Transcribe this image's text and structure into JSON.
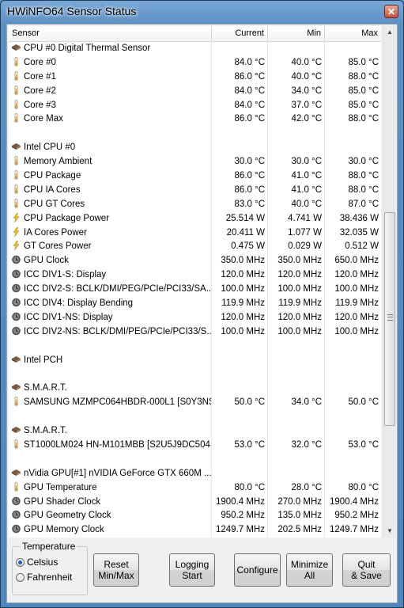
{
  "window": {
    "title": "HWiNFO64 Sensor Status",
    "close_label": "✕"
  },
  "columns": {
    "sensor": "Sensor",
    "current": "Current",
    "min": "Min",
    "max": "Max"
  },
  "rows": [
    {
      "name": "CPU #0 Digital Thermal Sensor",
      "icon": "chip",
      "current": "",
      "min": "",
      "max": ""
    },
    {
      "name": "Core #0",
      "icon": "thermometer",
      "current": "84.0 °C",
      "min": "40.0 °C",
      "max": "85.0 °C"
    },
    {
      "name": "Core #1",
      "icon": "thermometer",
      "current": "86.0 °C",
      "min": "40.0 °C",
      "max": "88.0 °C"
    },
    {
      "name": "Core #2",
      "icon": "thermometer",
      "current": "84.0 °C",
      "min": "34.0 °C",
      "max": "85.0 °C"
    },
    {
      "name": "Core #3",
      "icon": "thermometer",
      "current": "84.0 °C",
      "min": "37.0 °C",
      "max": "85.0 °C"
    },
    {
      "name": "Core Max",
      "icon": "thermometer",
      "current": "86.0 °C",
      "min": "42.0 °C",
      "max": "88.0 °C"
    },
    {
      "name": "",
      "icon": "",
      "current": "",
      "min": "",
      "max": ""
    },
    {
      "name": "Intel CPU #0",
      "icon": "chip",
      "current": "",
      "min": "",
      "max": ""
    },
    {
      "name": "Memory Ambient",
      "icon": "thermometer",
      "current": "30.0 °C",
      "min": "30.0 °C",
      "max": "30.0 °C"
    },
    {
      "name": "CPU Package",
      "icon": "thermometer",
      "current": "86.0 °C",
      "min": "41.0 °C",
      "max": "88.0 °C"
    },
    {
      "name": "CPU IA Cores",
      "icon": "thermometer",
      "current": "86.0 °C",
      "min": "41.0 °C",
      "max": "88.0 °C"
    },
    {
      "name": "CPU GT Cores",
      "icon": "thermometer",
      "current": "83.0 °C",
      "min": "40.0 °C",
      "max": "87.0 °C"
    },
    {
      "name": "CPU Package Power",
      "icon": "lightning",
      "current": "25.514 W",
      "min": "4.741 W",
      "max": "38.436 W"
    },
    {
      "name": "IA Cores Power",
      "icon": "lightning",
      "current": "20.411 W",
      "min": "1.077 W",
      "max": "32.035 W"
    },
    {
      "name": "GT Cores Power",
      "icon": "lightning",
      "current": "0.475 W",
      "min": "0.029 W",
      "max": "0.512 W"
    },
    {
      "name": "GPU Clock",
      "icon": "clock",
      "current": "350.0 MHz",
      "min": "350.0 MHz",
      "max": "650.0 MHz"
    },
    {
      "name": "ICC DIV1-S: Display",
      "icon": "clock",
      "current": "120.0 MHz",
      "min": "120.0 MHz",
      "max": "120.0 MHz"
    },
    {
      "name": "ICC DIV2-S: BCLK/DMI/PEG/PCIe/PCI33/SA...",
      "icon": "clock",
      "current": "100.0 MHz",
      "min": "100.0 MHz",
      "max": "100.0 MHz"
    },
    {
      "name": "ICC DIV4: Display Bending",
      "icon": "clock",
      "current": "119.9 MHz",
      "min": "119.9 MHz",
      "max": "119.9 MHz"
    },
    {
      "name": "ICC DIV1-NS: Display",
      "icon": "clock",
      "current": "120.0 MHz",
      "min": "120.0 MHz",
      "max": "120.0 MHz"
    },
    {
      "name": "ICC DIV2-NS: BCLK/DMI/PEG/PCIe/PCI33/S...",
      "icon": "clock",
      "current": "100.0 MHz",
      "min": "100.0 MHz",
      "max": "100.0 MHz"
    },
    {
      "name": "",
      "icon": "",
      "current": "",
      "min": "",
      "max": ""
    },
    {
      "name": "Intel PCH",
      "icon": "chip",
      "current": "",
      "min": "",
      "max": ""
    },
    {
      "name": "",
      "icon": "",
      "current": "",
      "min": "",
      "max": ""
    },
    {
      "name": "S.M.A.R.T.",
      "icon": "chip",
      "current": "",
      "min": "",
      "max": ""
    },
    {
      "name": "SAMSUNG MZMPC064HBDR-000L1 [S0Y3NS...",
      "icon": "thermometer",
      "current": "50.0 °C",
      "min": "34.0 °C",
      "max": "50.0 °C"
    },
    {
      "name": "",
      "icon": "",
      "current": "",
      "min": "",
      "max": ""
    },
    {
      "name": "S.M.A.R.T.",
      "icon": "chip",
      "current": "",
      "min": "",
      "max": ""
    },
    {
      "name": "ST1000LM024 HN-M101MBB [S2U5J9DC504...",
      "icon": "thermometer",
      "current": "53.0 °C",
      "min": "32.0 °C",
      "max": "53.0 °C"
    },
    {
      "name": "",
      "icon": "",
      "current": "",
      "min": "",
      "max": ""
    },
    {
      "name": "nVidia GPU[#1] nVIDIA GeForce GTX 660M ...",
      "icon": "chip",
      "current": "",
      "min": "",
      "max": ""
    },
    {
      "name": "GPU Temperature",
      "icon": "thermometer",
      "current": "80.0 °C",
      "min": "28.0 °C",
      "max": "80.0 °C"
    },
    {
      "name": "GPU Shader Clock",
      "icon": "clock",
      "current": "1900.4 MHz",
      "min": "270.0 MHz",
      "max": "1900.4 MHz"
    },
    {
      "name": "GPU Geometry Clock",
      "icon": "clock",
      "current": "950.2 MHz",
      "min": "135.0 MHz",
      "max": "950.2 MHz"
    },
    {
      "name": "GPU Memory Clock",
      "icon": "clock",
      "current": "1249.7 MHz",
      "min": "202.5 MHz",
      "max": "1249.7 MHz"
    }
  ],
  "temperature": {
    "legend": "Temperature",
    "celsius": "Celsius",
    "fahrenheit": "Fahrenheit",
    "selected": "Celsius"
  },
  "buttons": {
    "reset": "Reset\nMin/Max",
    "logging": "Logging\nStart",
    "configure": "Configure",
    "minimize": "Minimize\nAll",
    "quit": "Quit\n& Save"
  },
  "colors": {
    "title_bar": "#5b8fc4",
    "close_button": "#c4503a",
    "chip_icon": "#7a5a3a",
    "thermometer_icon": "#c8a060",
    "lightning_icon": "#f0c020",
    "clock_icon": "#555555"
  }
}
